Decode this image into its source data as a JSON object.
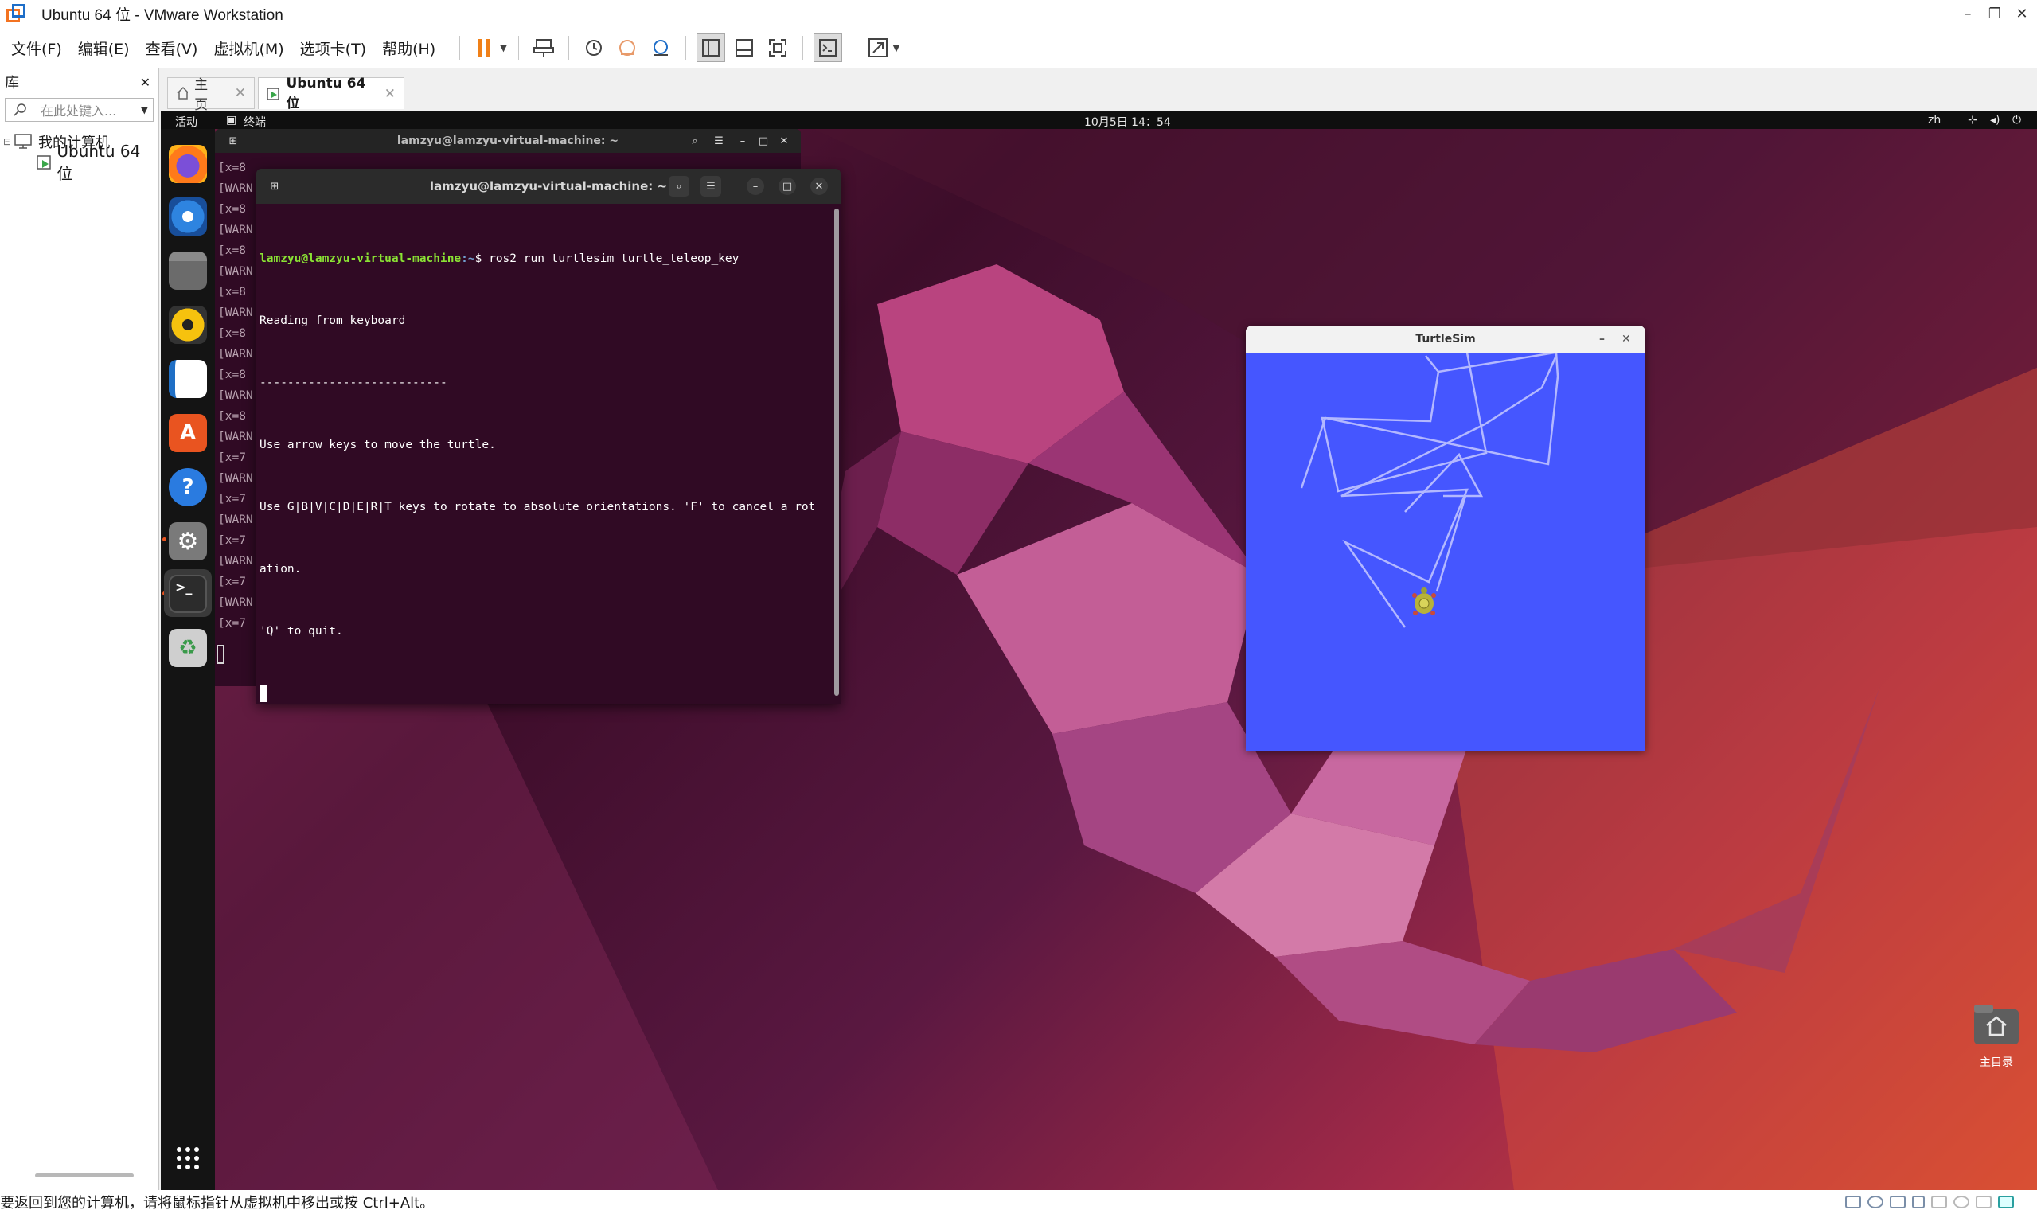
{
  "window": {
    "title": "Ubuntu 64 位 - VMware Workstation",
    "controls": {
      "minimize": "–",
      "restore": "❐",
      "close": "✕"
    }
  },
  "menubar": {
    "items": [
      "文件(F)",
      "编辑(E)",
      "查看(V)",
      "虚拟机(M)",
      "选项卡(T)",
      "帮助(H)"
    ]
  },
  "toolbar": {
    "icons": [
      "pause-icon",
      "send-keys-icon",
      "snapshot-icon",
      "revert-icon",
      "snapshot-manager-icon",
      "library-view-icon",
      "thumbnail-view-icon",
      "fullscreen-icon",
      "console-icon",
      "stretch-icon"
    ]
  },
  "library": {
    "title": "库",
    "close": "✕",
    "search_placeholder": "在此处键入...",
    "tree": {
      "root": "我的计算机",
      "child": "Ubuntu 64 位"
    }
  },
  "tabs": [
    {
      "label": "主页",
      "close": "✕",
      "active": false
    },
    {
      "label": "Ubuntu 64 位",
      "close": "✕",
      "active": true
    }
  ],
  "guest": {
    "topbar": {
      "activities": "活动",
      "app": "终端",
      "clock": "10月5日 14：54",
      "lang": "zh"
    },
    "back_terminal": {
      "title": "lamzyu@lamzyu-virtual-machine: ~",
      "lines": [
        "[x=8",
        "[WARN",
        "[x=8",
        "[WARN",
        "[x=8",
        "[WARN",
        "[x=8",
        "[WARN",
        "[x=8",
        "[WARN",
        "[x=8",
        "[WARN",
        "[x=8",
        "[WARN",
        "[x=7",
        "[WARN",
        "[x=7",
        "[WARN",
        "[x=7",
        "[WARN",
        "[x=7",
        "[WARN",
        "[x=7"
      ]
    },
    "front_terminal": {
      "title": "lamzyu@lamzyu-virtual-machine: ~",
      "prompt_user": "lamzyu@lamzyu-virtual-machine",
      "prompt_path": ":~",
      "command": "$ ros2 run turtlesim turtle_teleop_key",
      "output": [
        "Reading from keyboard",
        "---------------------------",
        "Use arrow keys to move the turtle.",
        "Use G|B|V|C|D|E|R|T keys to rotate to absolute orientations. 'F' to cancel a rot",
        "ation.",
        "'Q' to quit."
      ]
    },
    "turtlesim": {
      "title": "TurtleSim",
      "minimize": "–",
      "close": "✕",
      "background_color": "#4556ff",
      "pen_color": "#b3b8ff"
    },
    "home_folder": {
      "label": "主目录"
    }
  },
  "statusbar": {
    "message": "要返回到您的计算机，请将鼠标指针从虚拟机中移出或按 Ctrl+Alt。"
  }
}
